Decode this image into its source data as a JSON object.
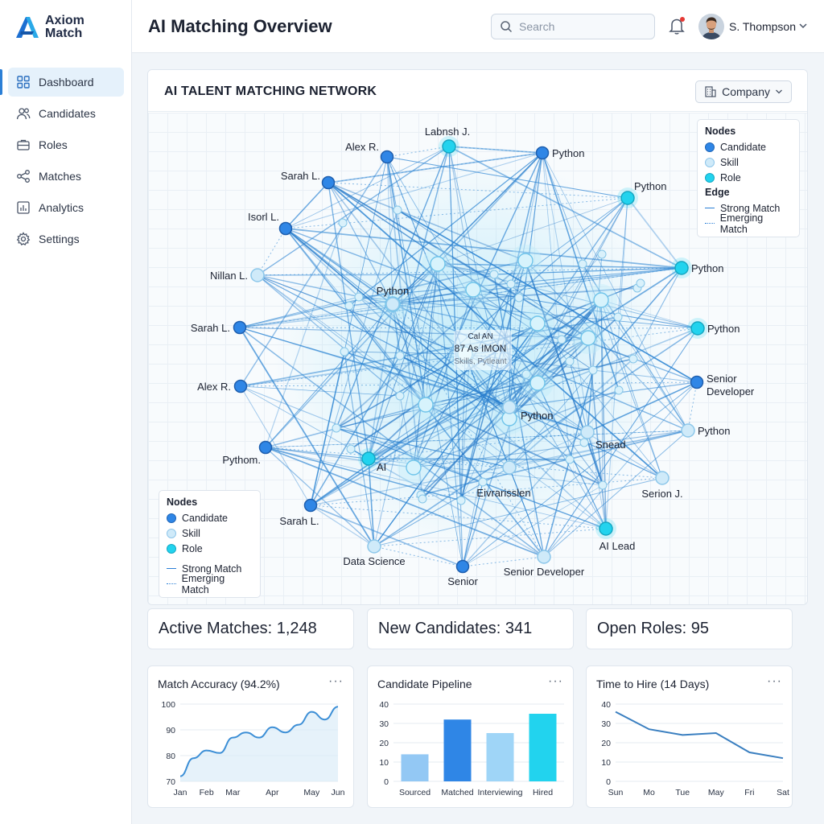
{
  "app": {
    "name_line1": "Axiom",
    "name_line2": "Match"
  },
  "sidebar": {
    "items": [
      {
        "label": "Dashboard",
        "icon": "grid-icon",
        "active": true
      },
      {
        "label": "Candidates",
        "icon": "users-icon"
      },
      {
        "label": "Roles",
        "icon": "briefcase-icon"
      },
      {
        "label": "Matches",
        "icon": "share-icon"
      },
      {
        "label": "Analytics",
        "icon": "bar-chart-icon"
      },
      {
        "label": "Settings",
        "icon": "gear-icon"
      }
    ]
  },
  "header": {
    "title": "AI Matching Overview",
    "search_placeholder": "Search",
    "user_name": "S. Thompson",
    "notification_dot": true
  },
  "network": {
    "title": "AI TALENT MATCHING NETWORK",
    "filter_label": "Company",
    "center_label_lines": [
      "Cal AN",
      "87 As IMON",
      "Skills, Pytleant"
    ],
    "nodes": [
      {
        "id": "n1",
        "label": "Alex R.",
        "type": "candidate"
      },
      {
        "id": "n2",
        "label": "Labnsh J.",
        "type": "role"
      },
      {
        "id": "n3",
        "label": "Python",
        "type": "candidate"
      },
      {
        "id": "n4",
        "label": "Sarah L.",
        "type": "candidate"
      },
      {
        "id": "n5",
        "label": "Python",
        "type": "role"
      },
      {
        "id": "n6",
        "label": "Isorl L.",
        "type": "candidate"
      },
      {
        "id": "n7",
        "label": "Nillan L.",
        "type": "skill"
      },
      {
        "id": "n8",
        "label": "Python",
        "type": "role"
      },
      {
        "id": "n9",
        "label": "Sarah L.",
        "type": "candidate"
      },
      {
        "id": "n10",
        "label": "Python",
        "type": "role"
      },
      {
        "id": "n11",
        "label": "Alex R.",
        "type": "candidate"
      },
      {
        "id": "n12",
        "label": "Senior Developer",
        "type": "candidate"
      },
      {
        "id": "n13",
        "label": "Python",
        "type": "skill"
      },
      {
        "id": "n14",
        "label": "Pythom.",
        "type": "candidate"
      },
      {
        "id": "n15",
        "label": "Serion J.",
        "type": "skill"
      },
      {
        "id": "n16",
        "label": "Sarah L.",
        "type": "candidate"
      },
      {
        "id": "n17",
        "label": "AI Lead",
        "type": "role"
      },
      {
        "id": "n18",
        "label": "Data Science",
        "type": "skill"
      },
      {
        "id": "n19",
        "label": "Senior",
        "type": "candidate"
      },
      {
        "id": "n20",
        "label": "Senior Developer",
        "type": "skill"
      },
      {
        "id": "n21",
        "label": "Python",
        "type": "skill"
      },
      {
        "id": "n22",
        "label": "Python",
        "type": "skill"
      },
      {
        "id": "n23",
        "label": "Snead",
        "type": "skill"
      },
      {
        "id": "n24",
        "label": "AI",
        "type": "role"
      },
      {
        "id": "n25",
        "label": "Eivrarisslen",
        "type": "skill"
      }
    ],
    "legend_top": {
      "nodes_title": "Nodes",
      "node_types": [
        {
          "label": "Candidate",
          "color": "#2f86e6"
        },
        {
          "label": "Skill",
          "color": "#bfe3f7"
        },
        {
          "label": "Role",
          "color": "#22d3ee"
        }
      ],
      "edge_title": "Edge",
      "edge_types": [
        {
          "label": "Strong Match",
          "style": "solid"
        },
        {
          "label": "Emerging Match",
          "style": "dotted"
        }
      ]
    },
    "legend_bottom": {
      "nodes_title": "Nodes",
      "node_types": [
        {
          "label": "Candidate",
          "color": "#2f86e6"
        },
        {
          "label": "Skill",
          "color": "#bfe3f7"
        },
        {
          "label": "Role",
          "color": "#22d3ee"
        }
      ],
      "edge_types": [
        {
          "label": "Strong Match",
          "style": "solid"
        },
        {
          "label": "Emerging Match",
          "style": "dotted"
        }
      ]
    }
  },
  "stats": [
    {
      "label": "Active Matches: 1,248"
    },
    {
      "label": "New Candidates: 341"
    },
    {
      "label": "Open Roles: 95"
    }
  ],
  "chart_data": [
    {
      "type": "area",
      "title": "Match Accuracy (94.2%)",
      "x": [
        "Jan",
        "",
        "Feb",
        "",
        "Mar",
        "",
        "",
        "Apr",
        "",
        "",
        "May",
        "",
        "Jun"
      ],
      "y_ticks": [
        100,
        90,
        80,
        70
      ],
      "ylim": [
        70,
        100
      ],
      "values": [
        72,
        79,
        82,
        81,
        87,
        89,
        87,
        91,
        89,
        92,
        97,
        94,
        99
      ],
      "color": "#3d8fd6"
    },
    {
      "type": "bar",
      "title": "Candidate Pipeline",
      "categories": [
        "Sourced",
        "Matched",
        "Interviewing",
        "Hired"
      ],
      "values": [
        14,
        32,
        25,
        35
      ],
      "colors": [
        "#93c8f4",
        "#2f86e6",
        "#9fd5f7",
        "#22d3ee"
      ],
      "y_ticks": [
        40,
        30,
        20,
        10,
        0
      ],
      "ylim": [
        0,
        40
      ]
    },
    {
      "type": "line",
      "title": "Time to Hire (14 Days)",
      "categories": [
        "Sun",
        "Mo",
        "Tue",
        "May",
        "Fri",
        "Sat"
      ],
      "values": [
        36,
        27,
        24,
        25,
        15,
        12
      ],
      "y_ticks": [
        40,
        30,
        20,
        10,
        0
      ],
      "ylim": [
        0,
        40
      ],
      "color": "#3a7fc0"
    }
  ]
}
